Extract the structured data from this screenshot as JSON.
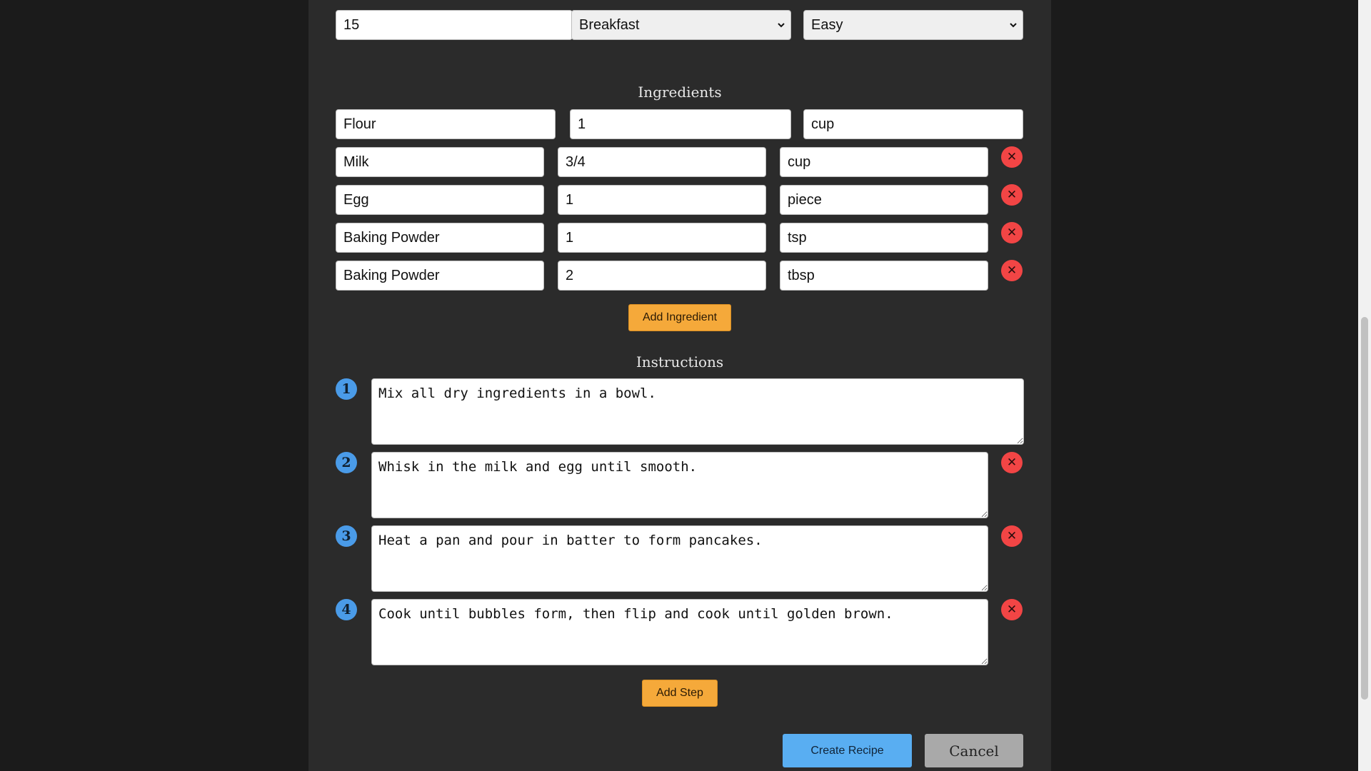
{
  "top_row": {
    "prep_time_value": "15",
    "category_value": "Breakfast",
    "category_options": [
      "Breakfast"
    ],
    "difficulty_value": "Easy",
    "difficulty_options": [
      "Easy"
    ]
  },
  "ingredients": {
    "title": "Ingredients",
    "rows": [
      {
        "name": "Flour",
        "amount": "1",
        "unit": "cup"
      },
      {
        "name": "Milk",
        "amount": "3/4",
        "unit": "cup"
      },
      {
        "name": "Egg",
        "amount": "1",
        "unit": "piece"
      },
      {
        "name": "Baking Powder",
        "amount": "1",
        "unit": "tsp"
      },
      {
        "name": "Baking Powder",
        "amount": "2",
        "unit": "tbsp"
      }
    ],
    "remove_symbol": "✕",
    "add_label": "Add Ingredient"
  },
  "instructions": {
    "title": "Instructions",
    "steps": [
      {
        "number": "1",
        "text": "Mix all dry ingredients in a bowl."
      },
      {
        "number": "2",
        "text": "Whisk in the milk and egg until smooth."
      },
      {
        "number": "3",
        "text": "Heat a pan and pour in batter to form pancakes."
      },
      {
        "number": "4",
        "text": "Cook until bubbles form, then flip and cook until golden brown."
      }
    ],
    "remove_symbol": "✕",
    "add_label": "Add Step"
  },
  "actions": {
    "create_label": "Create Recipe",
    "cancel_label": "Cancel"
  },
  "colors": {
    "page_bg": "#1b1b1b",
    "panel_bg": "#2b2b2b",
    "remove_red": "#f24545",
    "step_blue": "#4a9be8",
    "accent_orange": "#f5a93a",
    "primary_blue": "#59aef2"
  }
}
